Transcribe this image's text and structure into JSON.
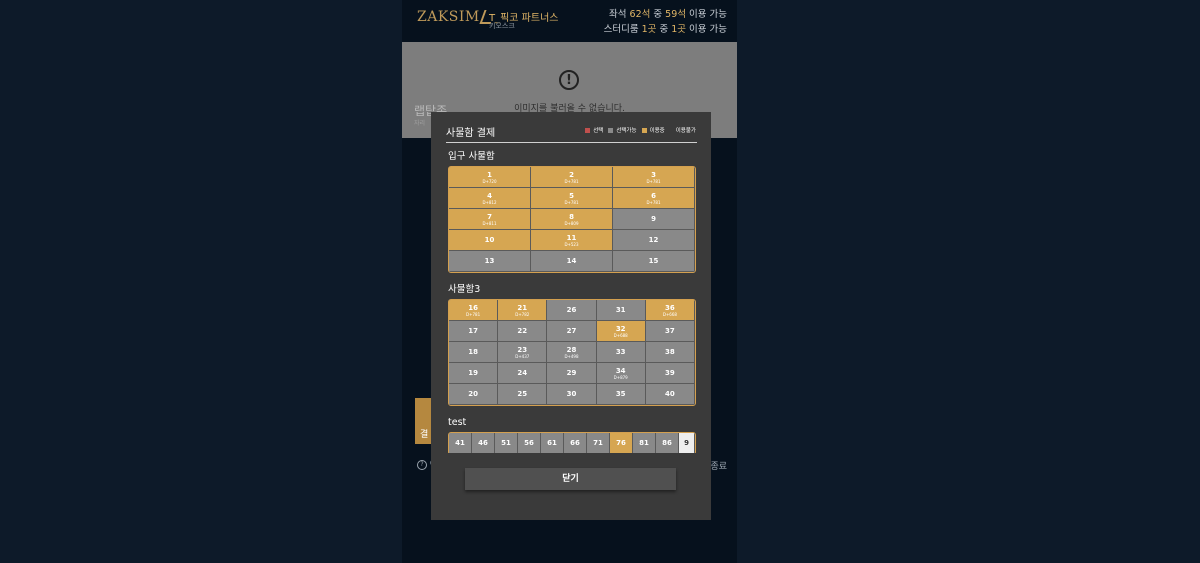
{
  "header": {
    "brand": "ZAKSIM",
    "store_name": "T_픽코 파트너스",
    "store_sub": "키오스크",
    "avail_line1": {
      "pre": "좌석 ",
      "a": "62석",
      "mid": " 중 ",
      "b": "59석",
      "post": " 이용 가능"
    },
    "avail_line2": {
      "pre": "스터디룸 ",
      "a": "1곳",
      "mid": " 중 ",
      "b": "1곳",
      "post": " 이용 가능"
    }
  },
  "background": {
    "image_error": "이미지를 불러올 수 없습니다.",
    "ghost_text": "랩탑존",
    "ghost_sub": "자리",
    "gold_label": "결",
    "bottom_left": "O",
    "bottom_right": "종료"
  },
  "modal": {
    "title": "사물함 결제",
    "legend": [
      {
        "label": "선택",
        "color": "#c0504d"
      },
      {
        "label": "선택가능",
        "color": "#8a8a8a"
      },
      {
        "label": "이용중",
        "color": "#d6a652"
      },
      {
        "label": "이용불가",
        "color": "#3a3a3a"
      }
    ],
    "sections": [
      {
        "title": "입구 사물함",
        "cols": 3,
        "cells": [
          {
            "n": "1",
            "s": "D+720",
            "st": "use"
          },
          {
            "n": "2",
            "s": "D+781",
            "st": "use"
          },
          {
            "n": "3",
            "s": "D+781",
            "st": "use"
          },
          {
            "n": "4",
            "s": "D+812",
            "st": "use"
          },
          {
            "n": "5",
            "s": "D+781",
            "st": "use"
          },
          {
            "n": "6",
            "s": "D+781",
            "st": "use"
          },
          {
            "n": "7",
            "s": "D+811",
            "st": "use"
          },
          {
            "n": "8",
            "s": "D+809",
            "st": "use"
          },
          {
            "n": "9",
            "s": "",
            "st": "avail"
          },
          {
            "n": "10",
            "s": "",
            "st": "use"
          },
          {
            "n": "11",
            "s": "D+523",
            "st": "use"
          },
          {
            "n": "12",
            "s": "",
            "st": "avail"
          },
          {
            "n": "13",
            "s": "",
            "st": "avail"
          },
          {
            "n": "14",
            "s": "",
            "st": "avail"
          },
          {
            "n": "15",
            "s": "",
            "st": "avail"
          }
        ]
      },
      {
        "title": "사물함3",
        "cols": 5,
        "cells": [
          {
            "n": "16",
            "s": "D+781",
            "st": "use"
          },
          {
            "n": "21",
            "s": "D+782",
            "st": "use"
          },
          {
            "n": "26",
            "s": "",
            "st": "avail"
          },
          {
            "n": "31",
            "s": "",
            "st": "avail"
          },
          {
            "n": "36",
            "s": "D+668",
            "st": "use"
          },
          {
            "n": "17",
            "s": "",
            "st": "avail"
          },
          {
            "n": "22",
            "s": "",
            "st": "avail"
          },
          {
            "n": "27",
            "s": "",
            "st": "avail"
          },
          {
            "n": "32",
            "s": "D+688",
            "st": "use"
          },
          {
            "n": "37",
            "s": "",
            "st": "avail"
          },
          {
            "n": "18",
            "s": "",
            "st": "avail"
          },
          {
            "n": "23",
            "s": "D+437",
            "st": "avail"
          },
          {
            "n": "28",
            "s": "D+498",
            "st": "avail"
          },
          {
            "n": "33",
            "s": "",
            "st": "avail"
          },
          {
            "n": "38",
            "s": "",
            "st": "avail"
          },
          {
            "n": "19",
            "s": "",
            "st": "avail"
          },
          {
            "n": "24",
            "s": "",
            "st": "avail"
          },
          {
            "n": "29",
            "s": "",
            "st": "avail"
          },
          {
            "n": "34",
            "s": "D+879",
            "st": "avail"
          },
          {
            "n": "39",
            "s": "",
            "st": "avail"
          },
          {
            "n": "20",
            "s": "",
            "st": "avail"
          },
          {
            "n": "25",
            "s": "",
            "st": "avail"
          },
          {
            "n": "30",
            "s": "",
            "st": "avail"
          },
          {
            "n": "35",
            "s": "",
            "st": "avail"
          },
          {
            "n": "40",
            "s": "",
            "st": "avail"
          }
        ]
      },
      {
        "title": "test",
        "cols": 11,
        "cells": [
          {
            "n": "41",
            "s": "",
            "st": "avail"
          },
          {
            "n": "46",
            "s": "",
            "st": "avail"
          },
          {
            "n": "51",
            "s": "",
            "st": "avail"
          },
          {
            "n": "56",
            "s": "",
            "st": "avail"
          },
          {
            "n": "61",
            "s": "",
            "st": "avail"
          },
          {
            "n": "66",
            "s": "",
            "st": "avail"
          },
          {
            "n": "71",
            "s": "",
            "st": "avail"
          },
          {
            "n": "76",
            "s": "",
            "st": "use"
          },
          {
            "n": "81",
            "s": "",
            "st": "avail"
          },
          {
            "n": "86",
            "s": "",
            "st": "avail"
          },
          {
            "n": "9",
            "s": "",
            "st": "white"
          }
        ]
      }
    ],
    "close_label": "닫기"
  }
}
